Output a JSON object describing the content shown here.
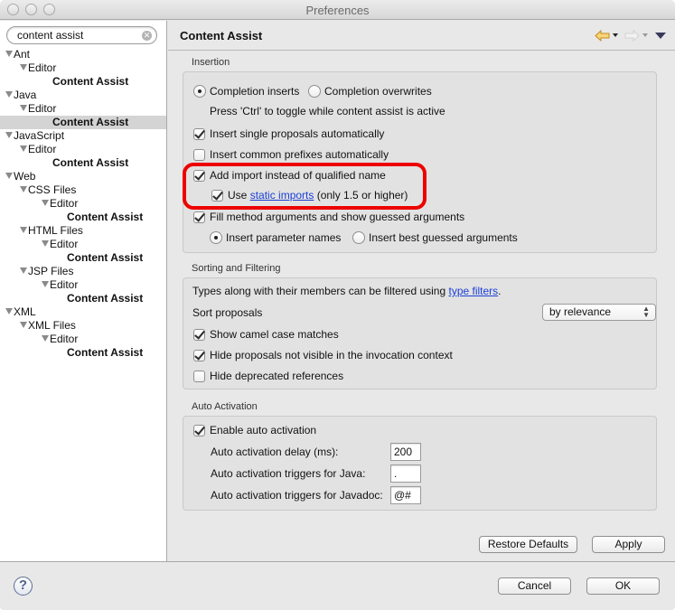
{
  "window": {
    "title": "Preferences"
  },
  "sidebar": {
    "search": {
      "value": "content assist",
      "clear_icon": "clear-icon"
    },
    "tree": [
      {
        "label": "Ant",
        "level": 0,
        "kind": "folder"
      },
      {
        "label": "Editor",
        "level": 1,
        "kind": "folder"
      },
      {
        "label": "Content Assist",
        "level": 2,
        "kind": "leaf"
      },
      {
        "label": "Java",
        "level": 0,
        "kind": "folder"
      },
      {
        "label": "Editor",
        "level": 1,
        "kind": "folder"
      },
      {
        "label": "Content Assist",
        "level": 2,
        "kind": "leaf",
        "selected": true
      },
      {
        "label": "JavaScript",
        "level": 0,
        "kind": "folder"
      },
      {
        "label": "Editor",
        "level": 1,
        "kind": "folder"
      },
      {
        "label": "Content Assist",
        "level": 2,
        "kind": "leaf"
      },
      {
        "label": "Web",
        "level": 0,
        "kind": "folder"
      },
      {
        "label": "CSS Files",
        "level": 1,
        "kind": "folder"
      },
      {
        "label": "Editor",
        "level": 2,
        "kind": "folder"
      },
      {
        "label": "Content Assist",
        "level": 3,
        "kind": "leaf"
      },
      {
        "label": "HTML Files",
        "level": 1,
        "kind": "folder"
      },
      {
        "label": "Editor",
        "level": 2,
        "kind": "folder"
      },
      {
        "label": "Content Assist",
        "level": 3,
        "kind": "leaf"
      },
      {
        "label": "JSP Files",
        "level": 1,
        "kind": "folder"
      },
      {
        "label": "Editor",
        "level": 2,
        "kind": "folder"
      },
      {
        "label": "Content Assist",
        "level": 3,
        "kind": "leaf"
      },
      {
        "label": "XML",
        "level": 0,
        "kind": "folder"
      },
      {
        "label": "XML Files",
        "level": 1,
        "kind": "folder"
      },
      {
        "label": "Editor",
        "level": 2,
        "kind": "folder"
      },
      {
        "label": "Content Assist",
        "level": 3,
        "kind": "leaf"
      }
    ]
  },
  "page": {
    "title": "Content Assist",
    "nav": {
      "back_icon": "back-arrow-icon",
      "forward_icon": "forward-arrow-icon",
      "menu_icon": "view-menu-icon"
    },
    "insertion": {
      "label": "Insertion",
      "completion_inserts": {
        "label": "Completion inserts",
        "selected": true
      },
      "completion_overwrites": {
        "label": "Completion overwrites",
        "selected": false
      },
      "toggle_hint": "Press 'Ctrl' to toggle while content assist is active",
      "insert_single": {
        "label": "Insert single proposals automatically",
        "checked": true
      },
      "insert_prefixes": {
        "label": "Insert common prefixes automatically",
        "checked": false
      },
      "add_import": {
        "label": "Add import instead of qualified name",
        "checked": true
      },
      "static_imports": {
        "prefix": "Use ",
        "link": "static imports",
        "suffix": " (only 1.5 or higher)",
        "checked": true
      },
      "fill_args": {
        "label": "Fill method arguments and show guessed arguments",
        "checked": true
      },
      "param_names": {
        "label": "Insert parameter names",
        "selected": true
      },
      "best_guessed": {
        "label": "Insert best guessed arguments",
        "selected": false
      }
    },
    "sorting": {
      "label": "Sorting and Filtering",
      "filter_text_prefix": "Types along with their members can be filtered using ",
      "filter_link": "type filters",
      "filter_text_suffix": ".",
      "sort_label": "Sort proposals",
      "sort_value": "by relevance",
      "camel_case": {
        "label": "Show camel case matches",
        "checked": true
      },
      "hide_not_visible": {
        "label": "Hide proposals not visible in the invocation context",
        "checked": true
      },
      "hide_deprecated": {
        "label": "Hide deprecated references",
        "checked": false
      }
    },
    "auto_activation": {
      "label": "Auto Activation",
      "enable": {
        "label": "Enable auto activation",
        "checked": true
      },
      "delay_label": "Auto activation delay (ms):",
      "delay_value": "200",
      "java_label": "Auto activation triggers for Java:",
      "java_value": ".",
      "javadoc_label": "Auto activation triggers for Javadoc:",
      "javadoc_value": "@#"
    },
    "restore_defaults": "Restore Defaults",
    "apply": "Apply"
  },
  "footer": {
    "help_icon": "help-icon",
    "cancel": "Cancel",
    "ok": "OK"
  },
  "annotation": {
    "highlight_color": "#ee0000"
  }
}
